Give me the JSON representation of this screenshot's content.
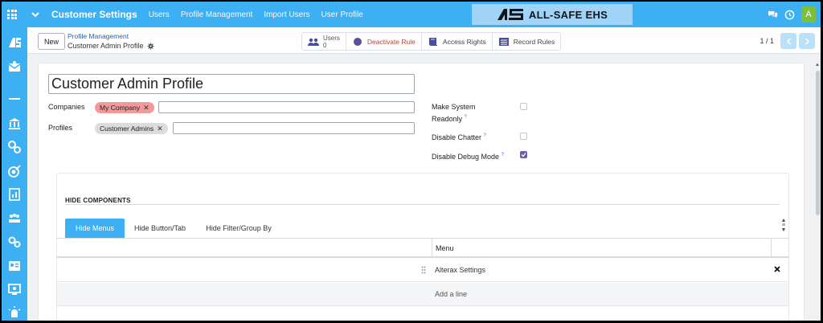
{
  "topbar": {
    "app_title": "Customer Settings",
    "links": [
      "Users",
      "Profile Management",
      "Import Users",
      "User Profile"
    ],
    "brand_text": "ALL-SAFE EHS",
    "avatar_letter": "A"
  },
  "control": {
    "new_label": "New",
    "breadcrumb_parent": "Profile Management",
    "breadcrumb_current": "Customer Admin Profile",
    "smart_buttons": {
      "users_label": "Users",
      "users_count": "0",
      "deactivate_label": "Deactivate Rule",
      "access_label": "Access Rights",
      "record_label": "Record Rules"
    },
    "pager": "1 / 1"
  },
  "form": {
    "name": "Customer Admin Profile",
    "companies_label": "Companies",
    "companies_tag": "My Company",
    "profiles_label": "Profiles",
    "profiles_tag": "Customer Admins",
    "readonly_label_1": "Make System",
    "readonly_label_2": "Readonly",
    "chatter_label": "Disable Chatter",
    "debug_label": "Disable Debug Mode",
    "help_mark": "?",
    "readonly_checked": false,
    "chatter_checked": false,
    "debug_checked": true
  },
  "components": {
    "section_title": "HIDE COMPONENTS",
    "tabs": [
      "Hide Menus",
      "Hide Button/Tab",
      "Hide Filter/Group By"
    ],
    "column_menu": "Menu",
    "rows": [
      "Alterax Settings"
    ],
    "add_line": "Add a line"
  },
  "colors": {
    "primary": "#3db0f3",
    "tag_red": "#f19a9a",
    "tag_gray": "#dadce0",
    "checkbox_checked": "#6c5fa8",
    "deactivate_text": "#b6443c"
  }
}
